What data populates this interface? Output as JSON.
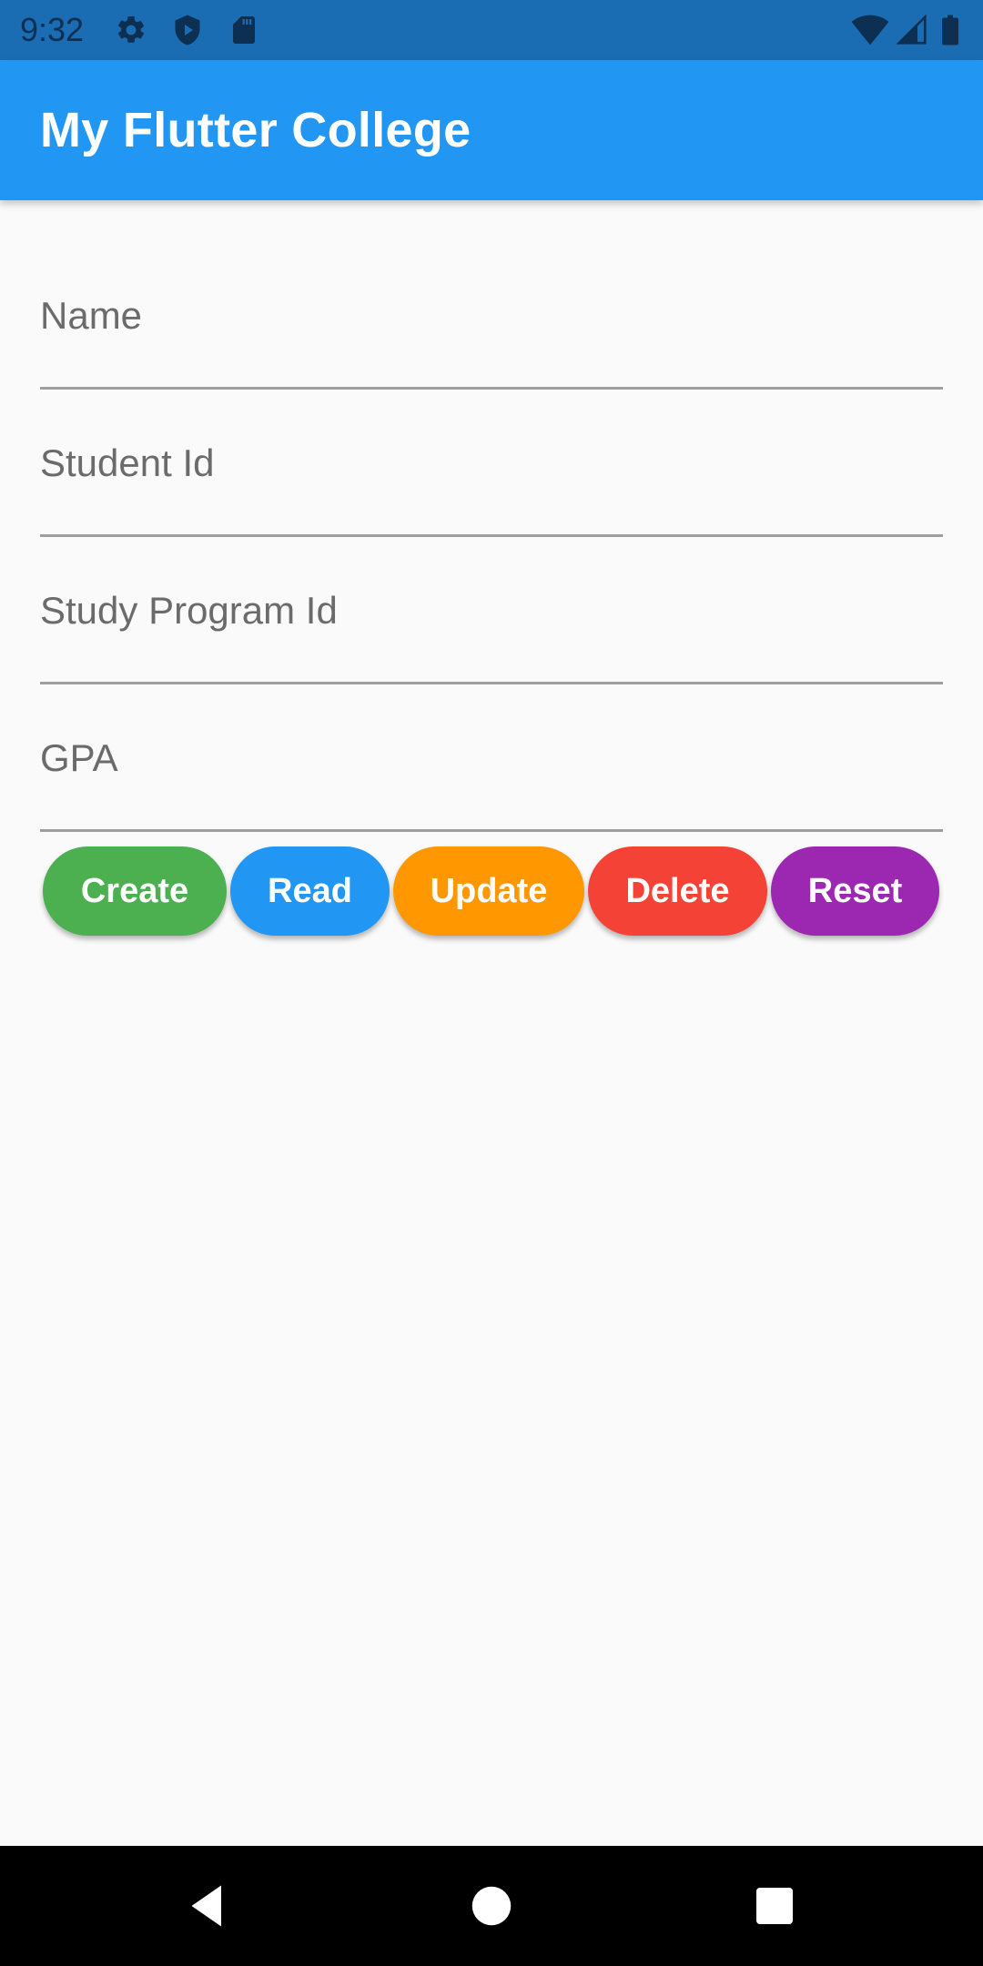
{
  "status_bar": {
    "time": "9:32",
    "left_icons": [
      "settings-icon",
      "shield-play-icon",
      "sd-card-icon"
    ],
    "right_icons": [
      "wifi-icon",
      "cell-signal-icon",
      "battery-icon"
    ]
  },
  "app_bar": {
    "title": "My Flutter College",
    "color": "#2196f3"
  },
  "form": {
    "fields": [
      {
        "label": "Name",
        "value": ""
      },
      {
        "label": "Student Id",
        "value": ""
      },
      {
        "label": "Study Program Id",
        "value": ""
      },
      {
        "label": "GPA",
        "value": ""
      }
    ]
  },
  "buttons": [
    {
      "label": "Create",
      "color": "#4caf50"
    },
    {
      "label": "Read",
      "color": "#2196f3"
    },
    {
      "label": "Update",
      "color": "#ff9800"
    },
    {
      "label": "Delete",
      "color": "#f44336"
    },
    {
      "label": "Reset",
      "color": "#9c27b0"
    }
  ],
  "nav_bar": {
    "icons": [
      "back-icon",
      "home-icon",
      "recents-icon"
    ]
  }
}
